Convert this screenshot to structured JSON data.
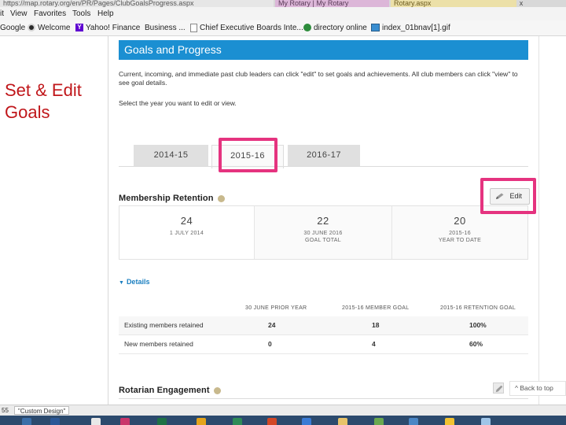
{
  "browser": {
    "tabs": [
      {
        "label": "https://map.rotary.org/en/PR/Pages/ClubGoalsProgress.aspx"
      },
      {
        "label": "My Rotary | My Rotary"
      },
      {
        "label": "Rotary.aspx"
      }
    ],
    "close_glyph": "x",
    "menu": [
      "it",
      "View",
      "Favorites",
      "Tools",
      "Help"
    ],
    "favorites": [
      {
        "label": "Google",
        "icon": "none"
      },
      {
        "label": "Welcome",
        "icon": "welcome-icon"
      },
      {
        "label": "Yahoo! Finance",
        "icon": "yahoo-icon"
      },
      {
        "label": "Business ...",
        "icon": "building-icon"
      },
      {
        "label": "Chief Executive Boards Inte...",
        "icon": "page-icon"
      },
      {
        "label": "directory online",
        "icon": "globe-icon"
      },
      {
        "label": "index_01bnav[1].gif",
        "icon": "image-icon"
      }
    ],
    "yahoo_glyph": "Y"
  },
  "slide": {
    "title_line1": "Set & Edit",
    "title_line2": "Goals"
  },
  "page": {
    "header": "Goals and Progress",
    "intro": "Current, incoming, and immediate past club leaders can click \"edit\" to set goals and achievements. All club members can click \"view\" to see goal details.",
    "select_year": "Select the year you want to edit or view.",
    "year_tabs": [
      "2014-15",
      "2015-16",
      "2016-17"
    ],
    "selected_year": "2015-16",
    "highlight_color": "#e5337f",
    "header_color": "#1b8fd2",
    "membership": {
      "title": "Membership Retention",
      "edit_label": "Edit",
      "stats": [
        {
          "value": "24",
          "label1": "1 JULY 2014",
          "label2": ""
        },
        {
          "value": "22",
          "label1": "30 JUNE 2016",
          "label2": "GOAL TOTAL"
        },
        {
          "value": "20",
          "label1": "2015-16",
          "label2": "YEAR TO DATE"
        }
      ],
      "details_label": "Details",
      "columns": [
        "30 JUNE PRIOR YEAR",
        "2015-16 MEMBER GOAL",
        "2015-16 RETENTION GOAL"
      ],
      "rows": [
        {
          "label": "Existing members retained",
          "v1": "24",
          "v2": "18",
          "v3": "100%"
        },
        {
          "label": "New members retained",
          "v1": "0",
          "v2": "4",
          "v3": "60%"
        }
      ]
    },
    "rotarian": {
      "title": "Rotarian Engagement"
    },
    "back_to_top": "^ Back to top"
  },
  "statusbar": {
    "left": "55",
    "box": "\"Custom Design\""
  }
}
